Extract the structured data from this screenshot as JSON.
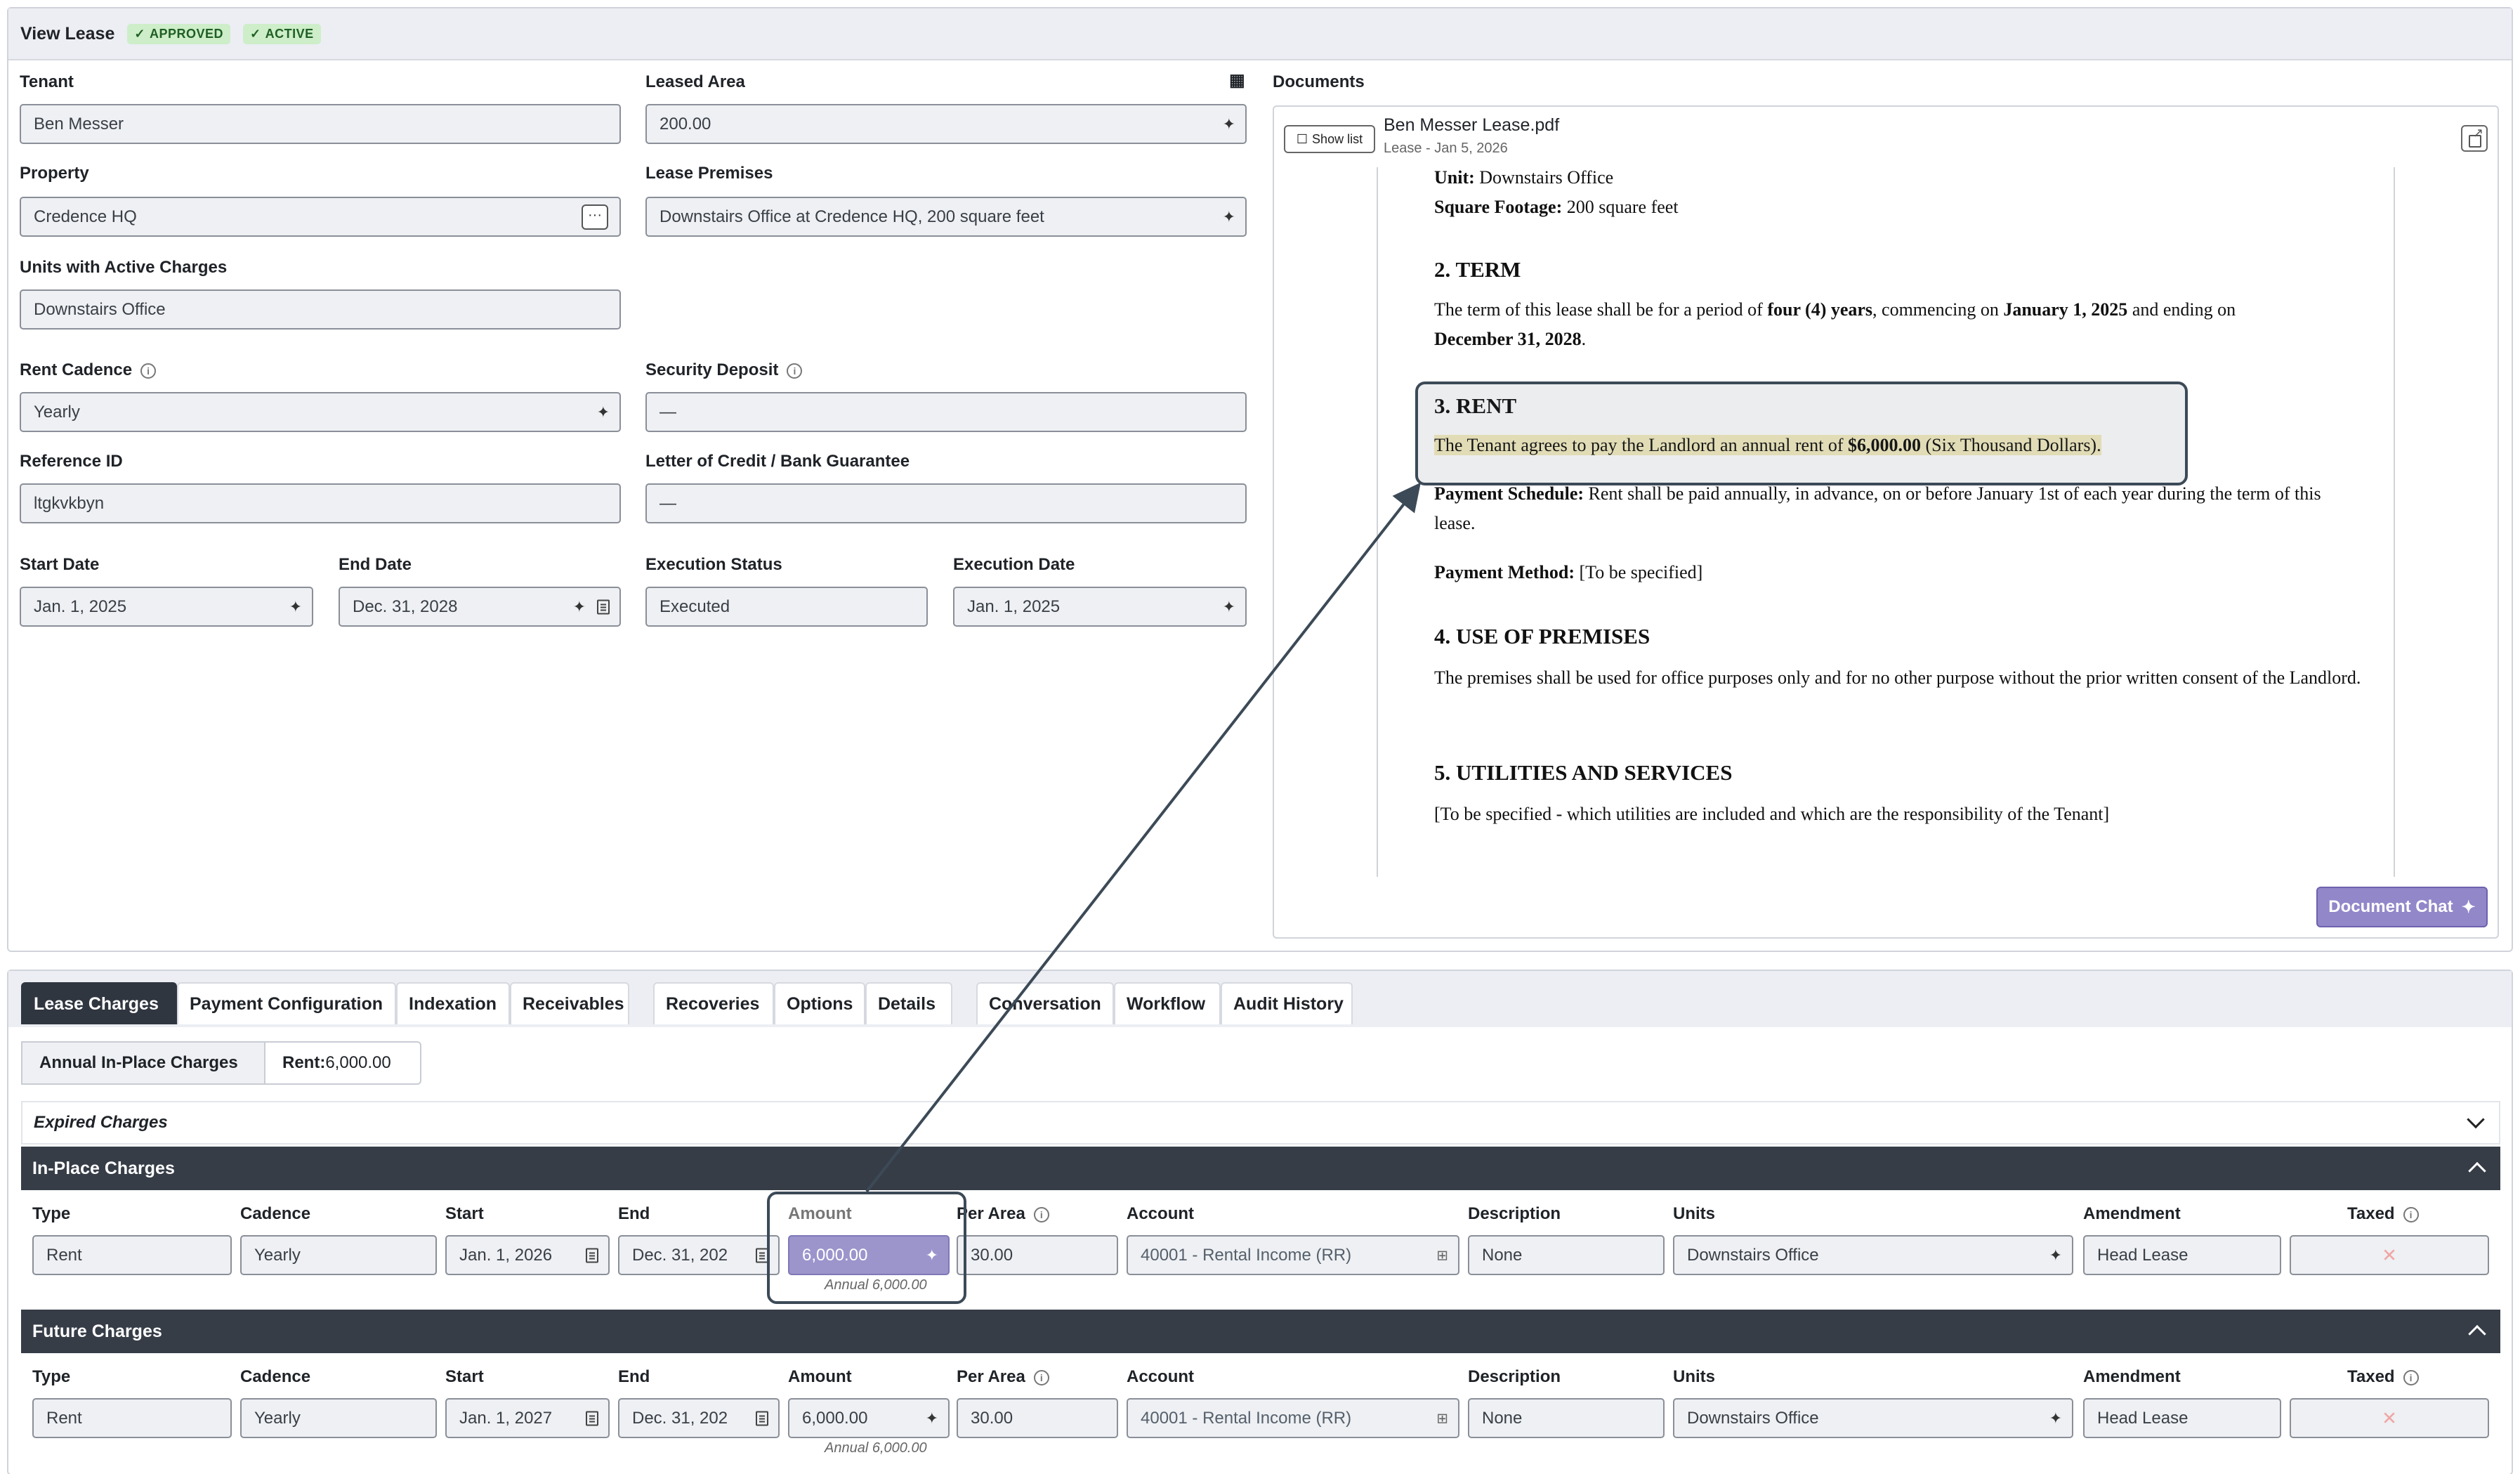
{
  "header": {
    "title": "View Lease",
    "badges": [
      "APPROVED",
      "ACTIVE"
    ]
  },
  "form": {
    "tenant": {
      "label": "Tenant",
      "value": "Ben Messer"
    },
    "leased_area": {
      "label": "Leased Area",
      "value": "200.00"
    },
    "property": {
      "label": "Property",
      "value": "Credence HQ"
    },
    "lease_premises": {
      "label": "Lease Premises",
      "value": "Downstairs Office at Credence HQ, 200 square feet"
    },
    "units_active": {
      "label": "Units with Active Charges",
      "value": "Downstairs Office"
    },
    "rent_cadence": {
      "label": "Rent Cadence",
      "value": "Yearly"
    },
    "security_deposit": {
      "label": "Security Deposit",
      "value": "—"
    },
    "reference_id": {
      "label": "Reference ID",
      "value": "ltgkvkbyn"
    },
    "letter_of_credit": {
      "label": "Letter of Credit / Bank Guarantee",
      "value": "—"
    },
    "start_date": {
      "label": "Start Date",
      "value": "Jan. 1, 2025"
    },
    "end_date": {
      "label": "End Date",
      "value": "Dec. 31, 2028"
    },
    "execution_status": {
      "label": "Execution Status",
      "value": "Executed"
    },
    "execution_date": {
      "label": "Execution Date",
      "value": "Jan. 1, 2025"
    }
  },
  "documents": {
    "label": "Documents",
    "show_list": "Show list",
    "file_name": "Ben Messer Lease.pdf",
    "file_sub": "Lease - Jan 5, 2026",
    "chat_button": "Document Chat",
    "pdf": {
      "unit_label": "Unit:",
      "unit_value": " Downstairs Office",
      "sqft_label": "Square Footage:",
      "sqft_value": " 200 square feet",
      "h_term": "2. TERM",
      "term_1": "The term of this lease shall be for a period of ",
      "term_bold1": "four (4) years",
      "term_2": ", commencing on ",
      "term_bold2": "January 1, 2025",
      "term_3": " and ending on",
      "term_bold3": "December 31, 2028",
      "term_4": ".",
      "h_rent": "3. RENT",
      "rent_1": "The Tenant agrees to pay the Landlord an annual rent of ",
      "rent_bold": "$6,000.00",
      "rent_2": " (Six Thousand Dollars).",
      "pay_sched_label": "Payment Schedule:",
      "pay_sched_text": " Rent shall be paid annually, in advance, on or before January 1st of each year during the term of this lease.",
      "pay_method_label": "Payment Method:",
      "pay_method_text": " [To be specified]",
      "h_use": "4. USE OF PREMISES",
      "use_text": "The premises shall be used for office purposes only and for no other purpose without the prior written consent of the Landlord.",
      "h_util": "5. UTILITIES AND SERVICES",
      "util_text": "[To be specified - which utilities are included and which are the responsibility of the Tenant]"
    }
  },
  "tabs": [
    "Lease Charges",
    "Payment Configuration",
    "Indexation",
    "Receivables",
    "Recoveries",
    "Options",
    "Details",
    "Conversation",
    "Workflow",
    "Audit History"
  ],
  "summary": {
    "label": "Annual In-Place Charges",
    "rent_label": "Rent:",
    "rent_value": " 6,000.00"
  },
  "sections": {
    "expired": "Expired Charges",
    "in_place": "In-Place Charges",
    "future": "Future Charges"
  },
  "columns": [
    "Type",
    "Cadence",
    "Start",
    "End",
    "Amount",
    "Per Area",
    "Account",
    "Description",
    "Units",
    "Amendment",
    "Taxed"
  ],
  "in_place_row": {
    "type": "Rent",
    "cadence": "Yearly",
    "start": "Jan. 1, 2026",
    "end": "Dec. 31, 202",
    "amount": "6,000.00",
    "annual": "Annual 6,000.00",
    "per_area": "30.00",
    "account": "40001 - Rental Income (RR)",
    "description": "None",
    "units": "Downstairs Office",
    "amendment": "Head Lease"
  },
  "future_row": {
    "type": "Rent",
    "cadence": "Yearly",
    "start": "Jan. 1, 2027",
    "end": "Dec. 31, 202",
    "amount": "6,000.00",
    "annual": "Annual 6,000.00",
    "per_area": "30.00",
    "account": "40001 - Rental Income (RR)",
    "description": "None",
    "units": "Downstairs Office",
    "amendment": "Head Lease"
  }
}
